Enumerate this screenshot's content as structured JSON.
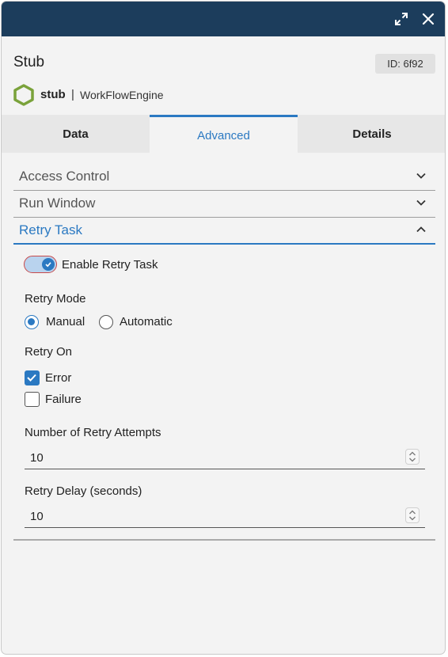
{
  "header": {
    "title": "Stub",
    "id_label": "ID: 6f92"
  },
  "subtitle": {
    "name": "stub",
    "separator": "|",
    "engine": "WorkFlowEngine"
  },
  "tabs": [
    {
      "label": "Data",
      "active": false
    },
    {
      "label": "Advanced",
      "active": true
    },
    {
      "label": "Details",
      "active": false
    }
  ],
  "sections": [
    {
      "label": "Access Control",
      "expanded": false
    },
    {
      "label": "Run Window",
      "expanded": false
    },
    {
      "label": "Retry Task",
      "expanded": true
    }
  ],
  "retry": {
    "enable_label": "Enable Retry Task",
    "enabled": true,
    "mode_label": "Retry Mode",
    "mode_options": [
      "Manual",
      "Automatic"
    ],
    "mode_selected": "Manual",
    "on_label": "Retry On",
    "on_options": [
      {
        "label": "Error",
        "checked": true
      },
      {
        "label": "Failure",
        "checked": false
      }
    ],
    "attempts_label": "Number of Retry Attempts",
    "attempts_value": "10",
    "delay_label": "Retry Delay (seconds)",
    "delay_value": "10"
  },
  "colors": {
    "titlebar": "#1c3d5c",
    "accent": "#2b79c2",
    "hex_icon": "#7aa23a"
  },
  "icons": {
    "expand": "expand-icon",
    "close": "close-icon",
    "logo": "hexagon-icon"
  }
}
